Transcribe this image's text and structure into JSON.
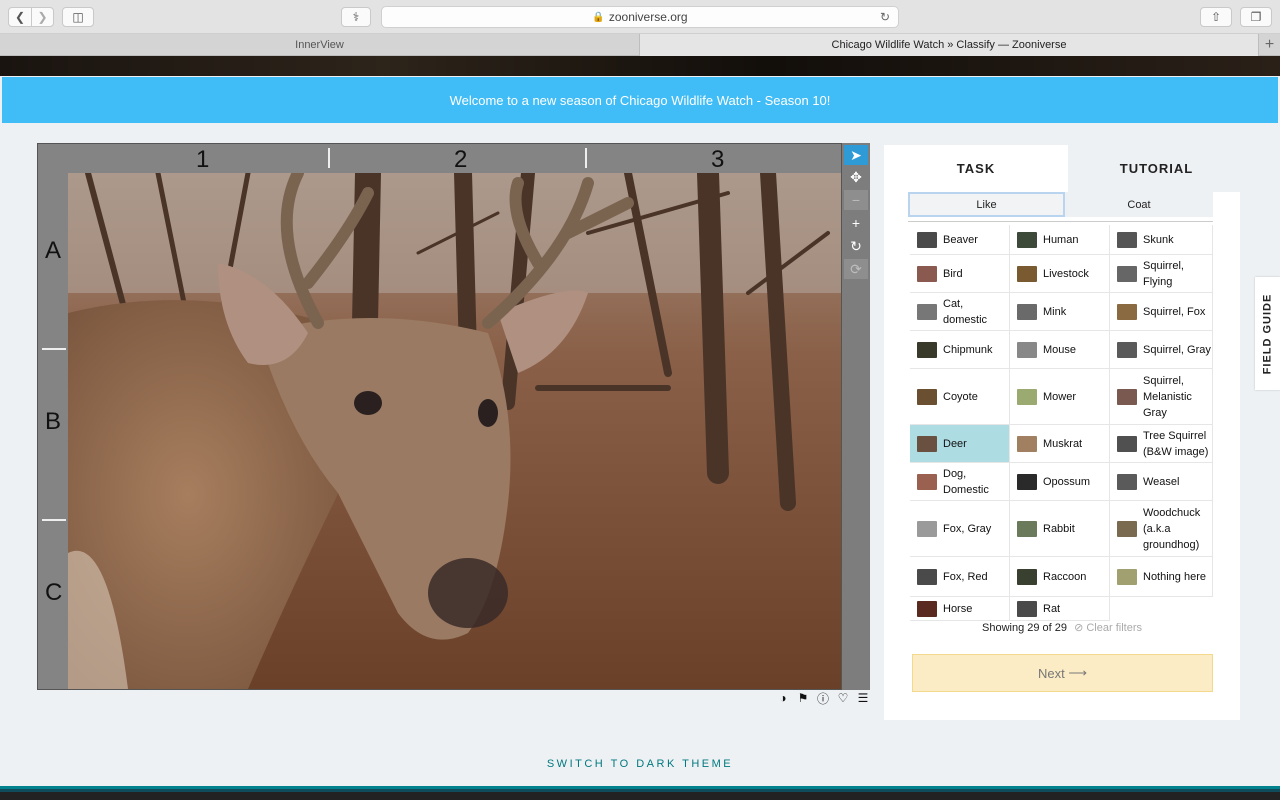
{
  "browser": {
    "url": "zooniverse.org",
    "tabs": [
      "InnerView",
      "Chicago Wildlife Watch » Classify — Zooniverse"
    ]
  },
  "banner": "Welcome to a new season of Chicago Wildlife Watch - Season 10!",
  "viewer": {
    "columns": [
      "1",
      "2",
      "3"
    ],
    "rows": [
      "A",
      "B",
      "C"
    ],
    "tools": [
      "pointer-icon",
      "move-icon",
      "zoom-out-icon",
      "zoom-in-icon",
      "rotate-icon",
      "reset-icon"
    ],
    "meta_icons": [
      "contrast-icon",
      "flag-icon",
      "info-icon",
      "heart-icon",
      "collections-icon"
    ]
  },
  "panel": {
    "tabs": [
      "TASK",
      "TUTORIAL"
    ],
    "filters": [
      "Like",
      "Coat"
    ],
    "choices": [
      {
        "label": "Beaver",
        "color": "#4a4a4a"
      },
      {
        "label": "Human",
        "color": "#3d4a3a"
      },
      {
        "label": "Skunk",
        "color": "#555555"
      },
      {
        "label": "Bird",
        "color": "#8a5a50"
      },
      {
        "label": "Livestock",
        "color": "#7a5a30"
      },
      {
        "label": "Squirrel, Flying",
        "color": "#666666"
      },
      {
        "label": "Cat, domestic",
        "color": "#777777"
      },
      {
        "label": "Mink",
        "color": "#6a6a6a"
      },
      {
        "label": "Squirrel, Fox",
        "color": "#8a6a40"
      },
      {
        "label": "Chipmunk",
        "color": "#3a3a2a"
      },
      {
        "label": "Mouse",
        "color": "#888888"
      },
      {
        "label": "Squirrel, Gray",
        "color": "#5a5a5a"
      },
      {
        "label": "Coyote",
        "color": "#6a5030"
      },
      {
        "label": "Mower",
        "color": "#9aaa70"
      },
      {
        "label": "Squirrel, Melanistic Gray",
        "color": "#7a5a50"
      },
      {
        "label": "Deer",
        "color": "#6a5040",
        "selected": true
      },
      {
        "label": "Muskrat",
        "color": "#a08060"
      },
      {
        "label": "Tree Squirrel (B&W image)",
        "color": "#505050"
      },
      {
        "label": "Dog, Domestic",
        "color": "#9a6050"
      },
      {
        "label": "Opossum",
        "color": "#2a2a2a"
      },
      {
        "label": "Weasel",
        "color": "#5a5a5a"
      },
      {
        "label": "Fox, Gray",
        "color": "#9a9a9a"
      },
      {
        "label": "Rabbit",
        "color": "#6a7a5a"
      },
      {
        "label": "Woodchuck (a.k.a groundhog)",
        "color": "#7a6a50"
      },
      {
        "label": "Fox, Red",
        "color": "#4a4a4a"
      },
      {
        "label": "Raccoon",
        "color": "#3a4030"
      },
      {
        "label": "Nothing here",
        "color": "#a0a070"
      },
      {
        "label": "Horse",
        "color": "#5a2a20"
      },
      {
        "label": "Rat",
        "color": "#4a4a4a"
      }
    ],
    "showing": "Showing 29 of 29",
    "clear_filters": "Clear filters",
    "next": "Next"
  },
  "field_guide": "FIELD GUIDE",
  "dark_theme": "SWITCH TO DARK THEME"
}
